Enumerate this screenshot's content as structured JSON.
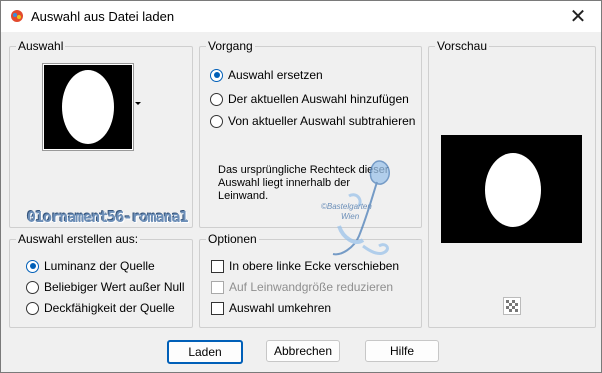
{
  "window": {
    "title": "Auswahl aus Datei laden",
    "close_icon": "close-icon",
    "app_icon": "paint-app-icon"
  },
  "auswahl": {
    "legend": "Auswahl",
    "dropdown_icon": "dropdown-arrow-icon"
  },
  "vorgang": {
    "legend": "Vorgang",
    "options": [
      {
        "label": "Auswahl ersetzen",
        "selected": true
      },
      {
        "label": "Der aktuellen Auswahl hinzufügen",
        "selected": false
      },
      {
        "label": "Von aktueller Auswahl subtrahieren",
        "selected": false
      }
    ],
    "info_text": [
      "Das ursprüngliche Rechteck dieser",
      "Auswahl liegt innerhalb der",
      "Leinwand."
    ]
  },
  "vorschau": {
    "legend": "Vorschau",
    "transparency_icon": "checkerboard-icon"
  },
  "erstellen": {
    "legend": "Auswahl erstellen aus:",
    "options": [
      {
        "label": "Luminanz der Quelle",
        "selected": true
      },
      {
        "label": "Beliebiger Wert außer Null",
        "selected": false
      },
      {
        "label": "Deckfähigkeit der Quelle",
        "selected": false
      }
    ]
  },
  "optionen": {
    "legend": "Optionen",
    "checks": [
      {
        "label": "In obere linke Ecke verschieben",
        "checked": false,
        "disabled": false
      },
      {
        "label": "Auf Leinwandgröße reduzieren",
        "checked": false,
        "disabled": true
      },
      {
        "label": "Auswahl umkehren",
        "checked": false,
        "disabled": false
      }
    ]
  },
  "buttons": {
    "ok": "Laden",
    "cancel": "Abbrechen",
    "help": "Hilfe"
  },
  "watermark": {
    "text": "01ornament56-romana1",
    "stamp_line1": "©Bastelgarten",
    "stamp_line2": "Wien"
  }
}
